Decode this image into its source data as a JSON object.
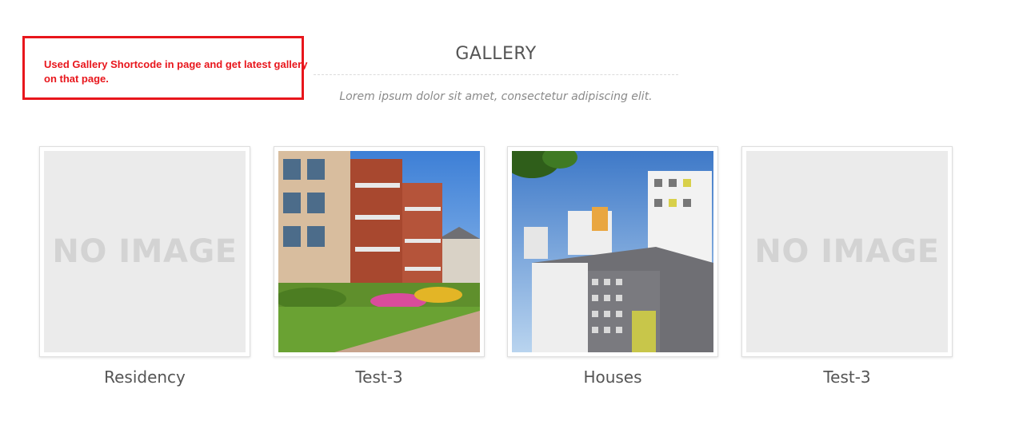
{
  "annotation": {
    "text": "Used Gallery Shortcode in page and get latest gallery on that page.",
    "color": "#e8161c"
  },
  "gallery": {
    "title": "GALLERY",
    "subtitle": "Lorem ipsum dolor sit amet, consectetur adipiscing elit.",
    "items": [
      {
        "caption": "Residency",
        "image": "no-image-placeholder",
        "placeholder_text": "NO IMAGE"
      },
      {
        "caption": "Test-3",
        "image": "apartment-building-photo"
      },
      {
        "caption": "Houses",
        "image": "high-rise-buildings-photo"
      },
      {
        "caption": "Test-3",
        "image": "no-image-placeholder",
        "placeholder_text": "NO IMAGE"
      }
    ]
  }
}
